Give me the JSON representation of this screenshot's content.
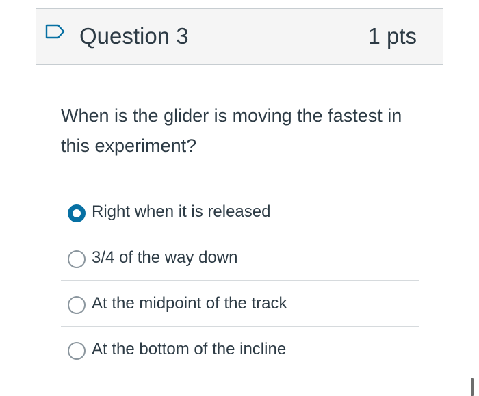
{
  "question": {
    "title": "Question 3",
    "points": "1 pts",
    "text": "When is the glider is moving the fastest in this experiment?",
    "flag_icon": "flag-outline-icon",
    "answers": [
      {
        "label": "Right when it is released",
        "selected": true
      },
      {
        "label": "3/4 of the way down",
        "selected": false
      },
      {
        "label": "At the midpoint of the track",
        "selected": false
      },
      {
        "label": "At the bottom of the incline",
        "selected": false
      }
    ]
  },
  "colors": {
    "accent": "#0770a3",
    "text": "#2d3b45",
    "header_bg": "#f5f5f5",
    "border": "#c7cdd1"
  }
}
